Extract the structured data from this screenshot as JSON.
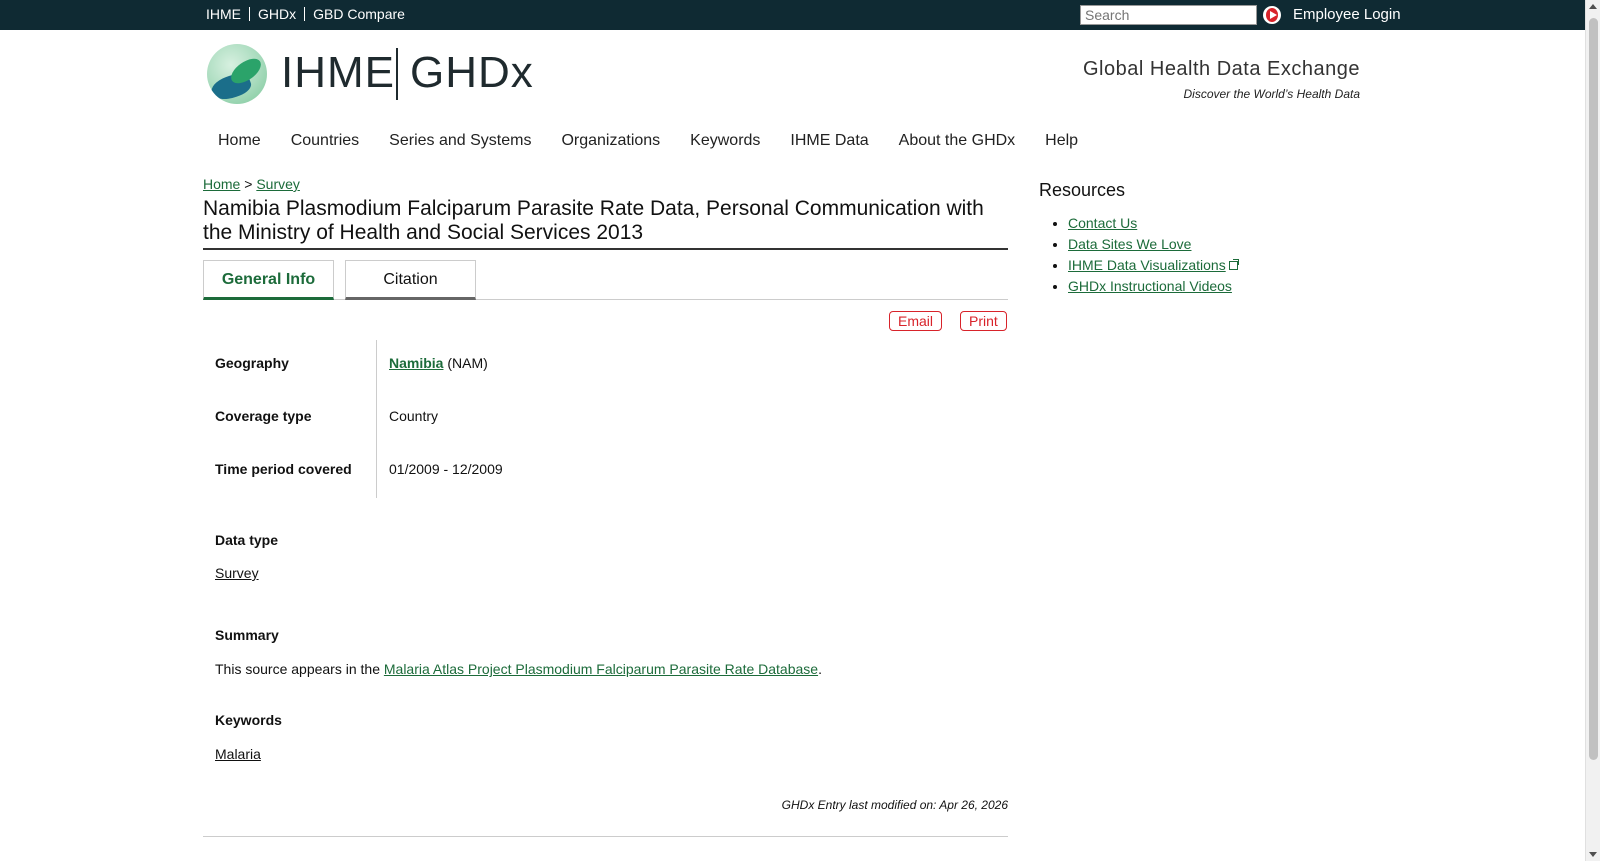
{
  "topbar": {
    "links": [
      "IHME",
      "GHDx",
      "GBD Compare"
    ],
    "search_placeholder": "Search",
    "login_label": "Employee Login"
  },
  "header": {
    "logo_left": "IHME",
    "logo_right": "GHDx",
    "tagline_title": "Global Health Data Exchange",
    "tagline_sub": "Discover the World’s Health Data"
  },
  "nav": {
    "items": [
      "Home",
      "Countries",
      "Series and Systems",
      "Organizations",
      "Keywords",
      "IHME Data",
      "About the GHDx",
      "Help"
    ]
  },
  "breadcrumb": {
    "home": "Home",
    "separator": ">",
    "current": "Survey"
  },
  "page": {
    "title": "Namibia Plasmodium Falciparum Parasite Rate Data, Personal Communication with the Ministry of Health and Social Services 2013",
    "tabs": [
      "General Info",
      "Citation"
    ],
    "email_label": "Email",
    "print_label": "Print"
  },
  "fields": {
    "geography_label": "Geography",
    "geography_link": "Namibia",
    "geography_code": "(NAM)",
    "coverage_label": "Coverage type",
    "coverage_value": "Country",
    "time_label": "Time period covered",
    "time_value": "01/2009 - 12/2009"
  },
  "sections": {
    "data_type_label": "Data type",
    "data_type_value": "Survey",
    "summary_label": "Summary",
    "summary_prefix": "This source appears in the ",
    "summary_link": "Malaria Atlas Project Plasmodium Falciparum Parasite Rate Database",
    "summary_suffix": ".",
    "keywords_label": "Keywords",
    "keywords_value": "Malaria"
  },
  "footer": {
    "modified": "GHDx Entry last modified on: Apr 26, 2026"
  },
  "resources": {
    "title": "Resources",
    "items": [
      "Contact Us",
      "Data Sites We Love",
      "IHME Data Visualizations",
      "GHDx Instructional Videos"
    ]
  },
  "colors": {
    "topbar_bg": "#0f2a33",
    "link": "#1c6b3a",
    "accent_red": "#d8232a"
  }
}
